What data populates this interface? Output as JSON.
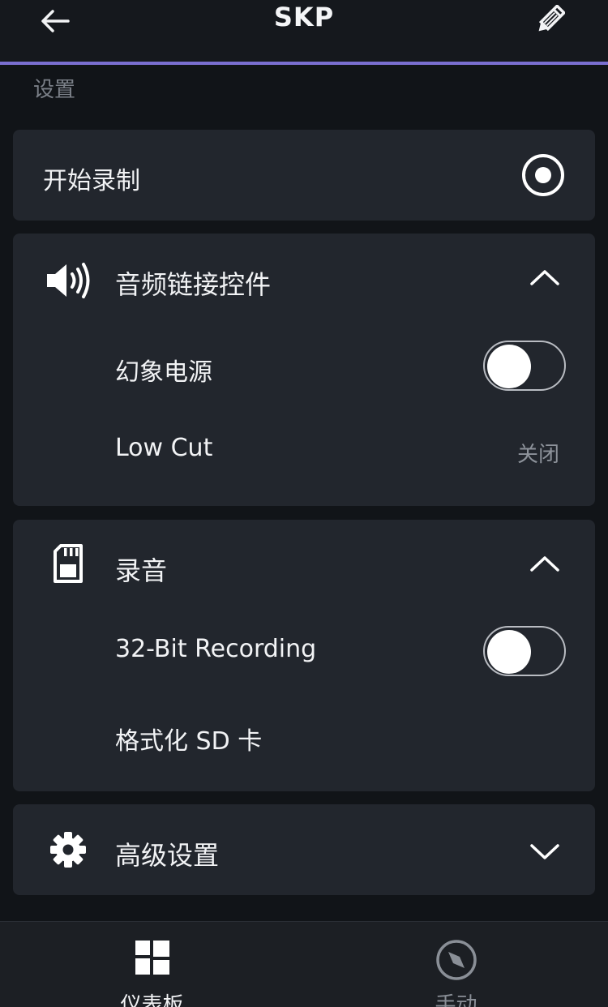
{
  "header": {
    "title": "SKP",
    "back_icon": "arrow-left-icon",
    "edit_icon": "pencil-icon",
    "accent_color": "#7a6fd0"
  },
  "section_label": "设置",
  "record": {
    "label": "开始录制",
    "icon": "record-icon"
  },
  "audio_controls": {
    "title": "音频链接控件",
    "icon": "speaker-icon",
    "expanded": true,
    "phantom_power": {
      "label": "幻象电源",
      "on": false
    },
    "low_cut": {
      "label": "Low Cut",
      "value": "关闭"
    }
  },
  "recording": {
    "title": "录音",
    "icon": "sd-card-icon",
    "expanded": true,
    "bit32": {
      "label": "32-Bit Recording",
      "on": false
    },
    "format_sd": {
      "label": "格式化 SD 卡"
    }
  },
  "advanced": {
    "title": "高级设置",
    "icon": "gear-icon",
    "expanded": false
  },
  "bottom_nav": {
    "items": [
      {
        "label": "仪表板",
        "icon": "dashboard-icon",
        "active": true
      },
      {
        "label": "手动",
        "icon": "compass-icon",
        "active": false
      }
    ]
  }
}
